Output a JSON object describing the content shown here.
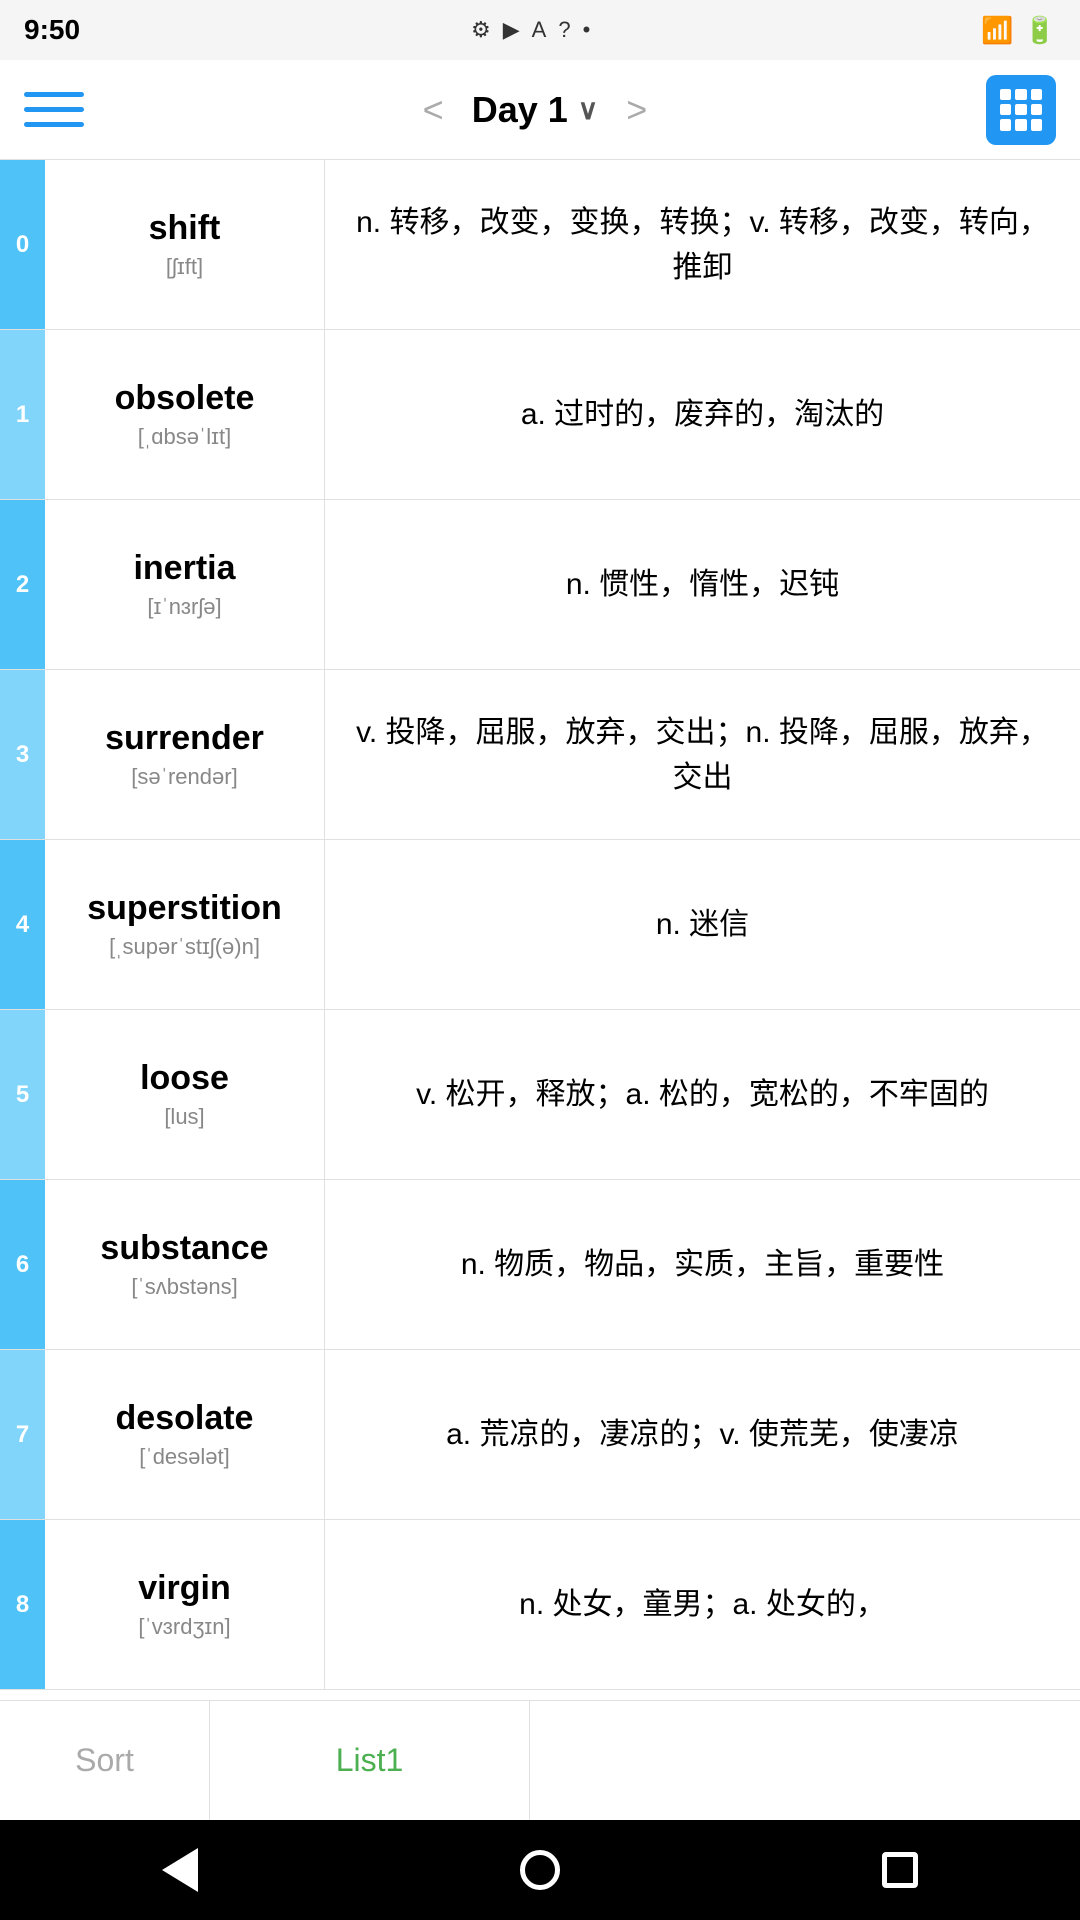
{
  "statusBar": {
    "time": "9:50",
    "icons": [
      "⚙",
      "▶",
      "A",
      "?",
      "•"
    ]
  },
  "navBar": {
    "title": "Day 1",
    "prevLabel": "<",
    "nextLabel": ">",
    "menuLabel": "Menu",
    "gridLabel": "Grid View"
  },
  "words": [
    {
      "index": "0",
      "term": "shift",
      "phonetic": "[ʃɪft]",
      "definition": "n. 转移，改变，变换，转换；v. 转移，改变，转向，推卸"
    },
    {
      "index": "1",
      "term": "obsolete",
      "phonetic": "[ˌɑbsəˈlɪt]",
      "definition": "a. 过时的，废弃的，淘汰的"
    },
    {
      "index": "2",
      "term": "inertia",
      "phonetic": "[ɪˈnɜrʃə]",
      "definition": "n. 惯性，惰性，迟钝"
    },
    {
      "index": "3",
      "term": "surrender",
      "phonetic": "[səˈrendər]",
      "definition": "v. 投降，屈服，放弃，交出；n. 投降，屈服，放弃，交出"
    },
    {
      "index": "4",
      "term": "superstition",
      "phonetic": "[ˌsupərˈstɪʃ(ə)n]",
      "definition": "n. 迷信"
    },
    {
      "index": "5",
      "term": "loose",
      "phonetic": "[lus]",
      "definition": "v. 松开，释放；a. 松的，宽松的，不牢固的"
    },
    {
      "index": "6",
      "term": "substance",
      "phonetic": "[ˈsʌbstəns]",
      "definition": "n. 物质，物品，实质，主旨，重要性"
    },
    {
      "index": "7",
      "term": "desolate",
      "phonetic": "[ˈdesələt]",
      "definition": "a. 荒凉的，凄凉的；v. 使荒芜，使凄凉"
    },
    {
      "index": "8",
      "term": "virgin",
      "phonetic": "[ˈvɜrdʒɪn]",
      "definition": "n. 处女，童男；a. 处女的，"
    }
  ],
  "bottomBar": {
    "sortLabel": "Sort",
    "list1Label": "List1"
  },
  "androidNav": {
    "backLabel": "Back",
    "homeLabel": "Home",
    "recentLabel": "Recent"
  }
}
